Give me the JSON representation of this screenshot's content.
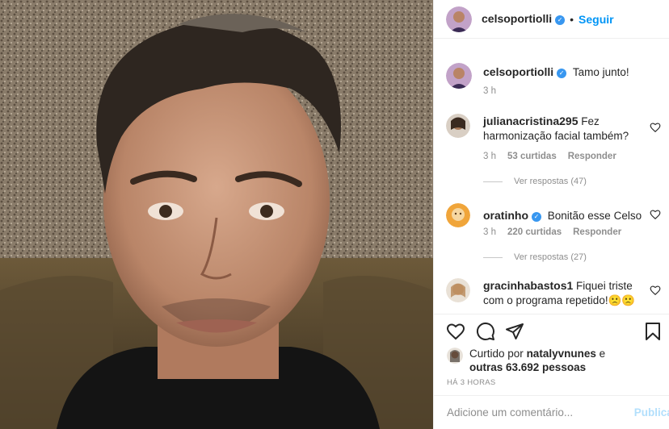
{
  "post": {
    "username": "celsoportiolli",
    "follow_label": "Seguir",
    "dot": "•",
    "caption": "Tamo junto!",
    "caption_time": "3 h",
    "verified_mark": "✓"
  },
  "comments": [
    {
      "user": "julianacristina295",
      "verified": false,
      "text": "Fez harmonização facial também?",
      "time": "3 h",
      "likes": "53 curtidas",
      "reply": "Responder",
      "view_replies": "Ver respostas (47)"
    },
    {
      "user": "oratinho",
      "verified": true,
      "text": "Bonitão esse Celso",
      "time": "3 h",
      "likes": "220 curtidas",
      "reply": "Responder",
      "view_replies": "Ver respostas (27)"
    },
    {
      "user": "gracinhabastos1",
      "verified": false,
      "text": "Fiquei triste com o programa repetido!🙁🙁"
    }
  ],
  "likes": {
    "prefix": "Curtido por",
    "liker": "natalyvnunes",
    "middle": "e",
    "others": "outras 63.692 pessoas"
  },
  "time_ago": "HÁ 3 HORAS",
  "add_comment": {
    "placeholder": "Adicione um comentário...",
    "publish": "Publicar"
  },
  "icons": {
    "like": "heart-icon",
    "comment": "comment-bubble-icon",
    "share": "paper-plane-icon",
    "save": "bookmark-icon"
  }
}
